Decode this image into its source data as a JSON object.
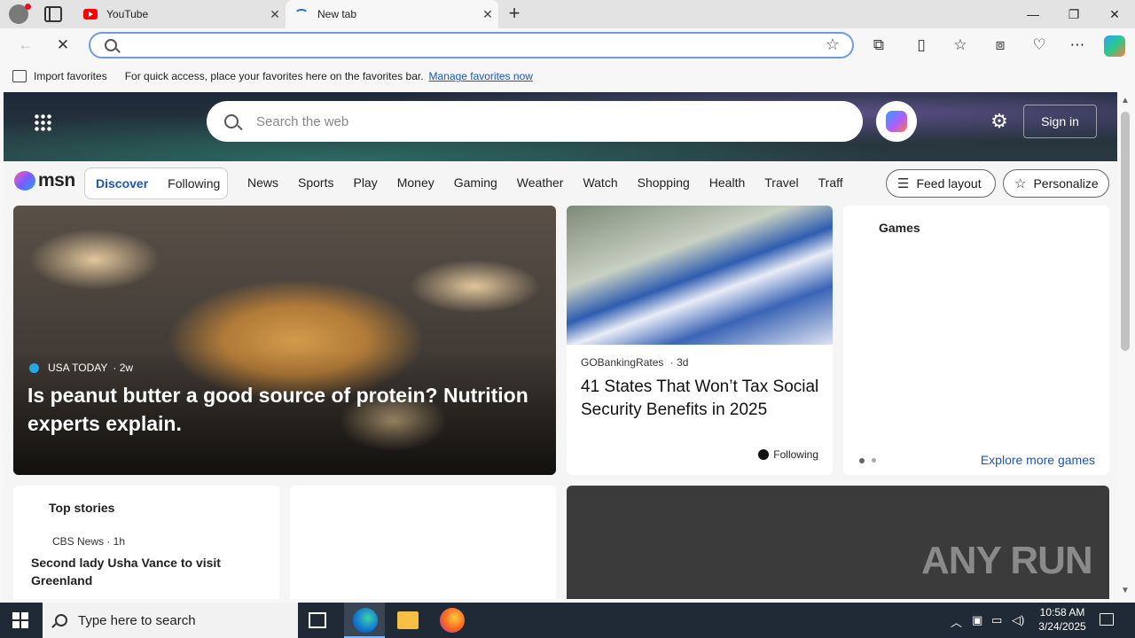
{
  "browser": {
    "tabs": [
      {
        "title": "YouTube",
        "active": false
      },
      {
        "title": "New tab",
        "active": true
      }
    ],
    "address_value": "",
    "favorites_bar": {
      "import_label": "Import favorites",
      "message": "For quick access, place your favorites here on the favorites bar.",
      "manage_link": "Manage favorites now"
    }
  },
  "msn": {
    "search_placeholder": "Search the web",
    "sign_in": "Sign in",
    "logo_text": "msn",
    "feed_tabs": {
      "discover": "Discover",
      "following": "Following"
    },
    "nav_links": [
      "News",
      "Sports",
      "Play",
      "Money",
      "Gaming",
      "Weather",
      "Watch",
      "Shopping",
      "Health",
      "Travel",
      "Traffic"
    ],
    "feed_layout": "Feed layout",
    "personalize": "Personalize",
    "hero": {
      "source": "USA TODAY",
      "age": "· 2w",
      "headline": "Is peanut butter a good source of protein? Nutrition experts explain."
    },
    "card_ss": {
      "source": "GOBankingRates",
      "age": "· 3d",
      "headline": "41 States That Won’t Tax Social Security Benefits in 2025",
      "following": "Following"
    },
    "games": {
      "title": "Games",
      "explore": "Explore more games"
    },
    "top_stories": {
      "title": "Top stories",
      "meta": "CBS News · 1h",
      "headline": "Second lady Usha Vance to visit Greenland"
    },
    "watermark": "ANY RUN"
  },
  "taskbar": {
    "search_placeholder": "Type here to search",
    "time": "10:58 AM",
    "date": "3/24/2025"
  },
  "colors": {
    "accent": "#1a56c4",
    "taskbar": "#1f2a36"
  }
}
